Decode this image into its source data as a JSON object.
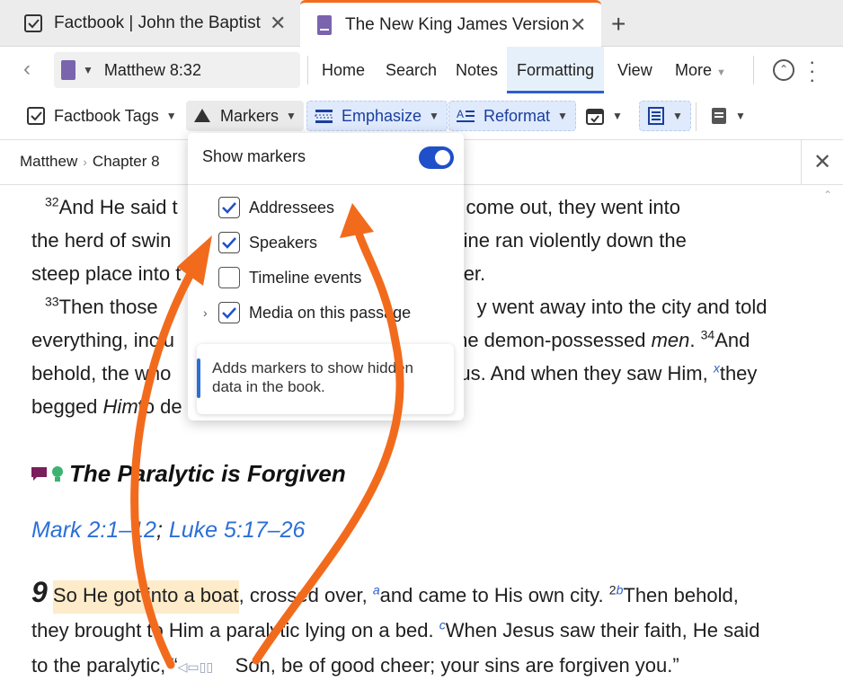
{
  "tabs": [
    {
      "label": "Factbook | John the Baptist",
      "icon": "factbook-icon",
      "active": false
    },
    {
      "label": "The New King James Version",
      "icon": "book-icon",
      "active": true
    }
  ],
  "nav": {
    "reference": "Matthew 8:32",
    "menu": [
      "Home",
      "Search",
      "Notes",
      "Formatting",
      "View",
      "More"
    ],
    "active_menu": "Formatting"
  },
  "toolbar": {
    "factbook_tags": "Factbook Tags",
    "markers": "Markers",
    "emphasize": "Emphasize",
    "reformat": "Reformat"
  },
  "breadcrumb": {
    "book": "Matthew",
    "chapter": "Chapter 8"
  },
  "popup": {
    "title": "Show markers",
    "options": [
      {
        "label": "Addressees",
        "checked": true
      },
      {
        "label": "Speakers",
        "checked": true
      },
      {
        "label": "Timeline events",
        "checked": false
      },
      {
        "label": "Media on this passage",
        "checked": true
      }
    ],
    "info": "Adds markers to show hidden data in the book."
  },
  "text": {
    "v32_num": "32",
    "v32_a": "And He said t",
    "v32_b": "n they had come out, they went into",
    "line2_a": "the herd of swin",
    "line2_b": "erd of swine ran violently down the",
    "line3_a": "steep place into t",
    "line3_b": "ater.",
    "v33_num": "33",
    "v33_a": "Then those",
    "v33_b": "y went away into the city and told",
    "line5_a": "everything, inclu",
    "line5_b": "the demon-possessed",
    "line5_men": "men",
    "v34_num": "34",
    "line5_c": "And",
    "line6_a": "behold, the who",
    "line6_b": "sus. And when they saw Him,",
    "line6_fn": "x",
    "line6_c": "they",
    "line7_a": "begged",
    "line7_him": "Him",
    "line7_b": "to de",
    "heading": "The Paralytic is Forgiven",
    "xref1": "Mark 2:1–12",
    "xref_sep": "; ",
    "xref2": "Luke 5:17–26",
    "ch_num": "9",
    "c1_hl": "So He got into a boat",
    "c1_b": ", crossed over,",
    "fn_a": "a",
    "c1_c": "and came to His own city.",
    "v2_num": "2",
    "fn_b": "b",
    "c1_d": "Then behold,",
    "c2": "they brought to Him a paralytic lying on a bed.",
    "fn_c": "c",
    "c2_b": "When Jesus saw their faith, He said",
    "c3_a": "to the paralytic, “",
    "c3_b": "Son, be of good cheer; your sins are forgiven you.”"
  },
  "colors": {
    "accent_orange": "#f26b1d",
    "brand_blue": "#1f4fc9",
    "link_blue": "#2b6fd6",
    "book_purple": "#7a64ad"
  }
}
